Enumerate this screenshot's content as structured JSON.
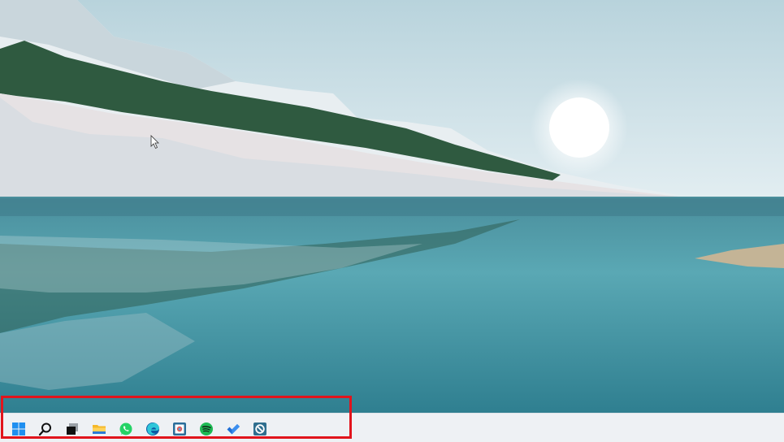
{
  "desktop": {
    "wallpaper": "lake-mountain-sunrise"
  },
  "colors": {
    "highlight": "#e1141c",
    "taskbar_bg": "#eef1f4",
    "accent": "#0078d4"
  },
  "taskbar": {
    "pinned": [
      {
        "id": "start",
        "icon": "windows-logo-icon"
      },
      {
        "id": "search",
        "icon": "search-icon"
      },
      {
        "id": "task-view",
        "icon": "task-view-icon"
      },
      {
        "id": "file-explorer",
        "icon": "folder-icon"
      },
      {
        "id": "whatsapp",
        "icon": "whatsapp-icon"
      },
      {
        "id": "edge",
        "icon": "edge-icon"
      },
      {
        "id": "app",
        "icon": "photo-app-icon"
      },
      {
        "id": "spotify",
        "icon": "spotify-icon"
      },
      {
        "id": "todo",
        "icon": "checkmark-icon"
      },
      {
        "id": "blocker",
        "icon": "block-app-icon"
      }
    ]
  }
}
